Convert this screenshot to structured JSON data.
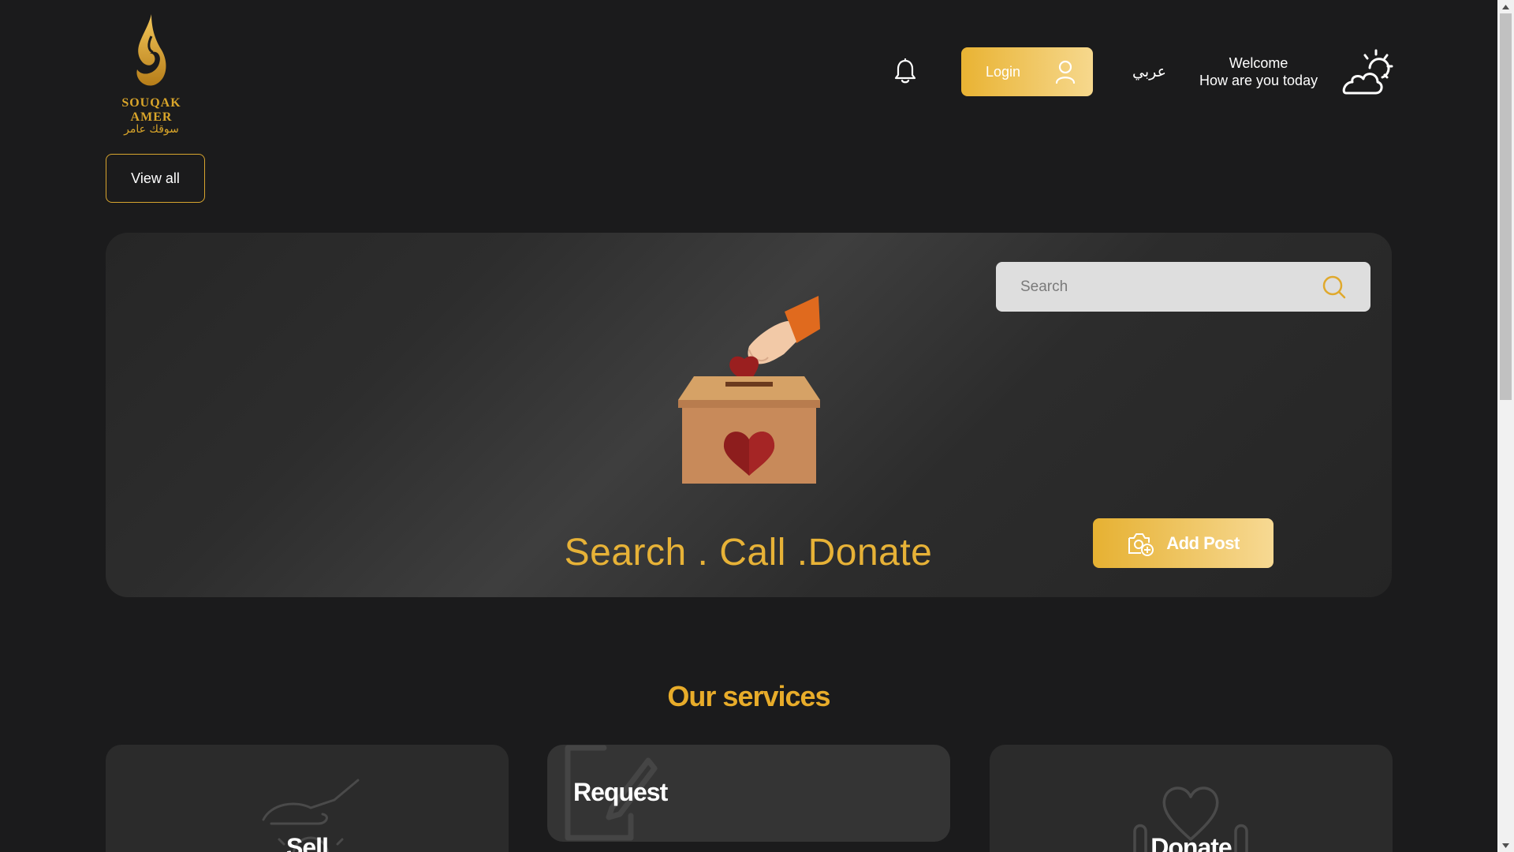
{
  "brand": {
    "name_en": "SOUQAK AMER",
    "name_ar": "سوقك عامر"
  },
  "header": {
    "login_label": "Login",
    "language_label": "عربي",
    "welcome_line1": "Welcome",
    "welcome_line2": "How are you today"
  },
  "view_all_label": "View all",
  "hero": {
    "search_placeholder": "Search",
    "tagline": "Search . Call .Donate",
    "add_post_label": "Add Post"
  },
  "services": {
    "title": "Our services",
    "items": [
      {
        "label": "Sell"
      },
      {
        "label": "Request"
      },
      {
        "label": "Donate"
      }
    ]
  },
  "icons": {
    "bell": "bell-icon",
    "user": "user-icon",
    "weather": "partly-cloudy-icon",
    "search": "search-icon",
    "camera_add": "camera-add-icon"
  },
  "colors": {
    "background": "#1b1b1c",
    "accent_gold": "#e7b237",
    "gold_light": "#f6d88d",
    "card": "#2b2b2b"
  }
}
